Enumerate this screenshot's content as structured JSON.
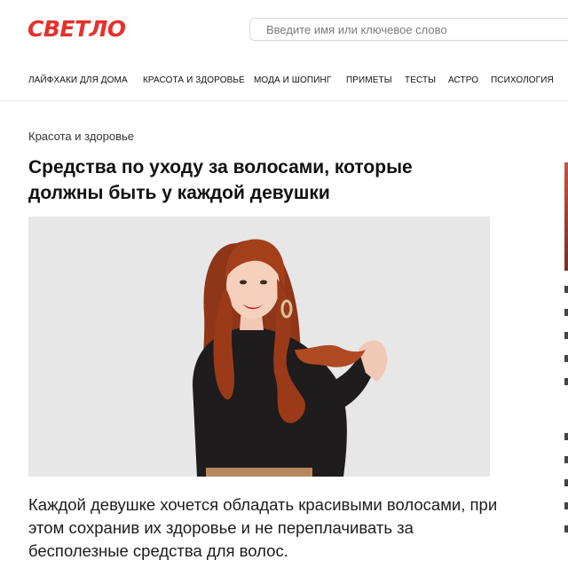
{
  "header": {
    "logo": "СВЕТЛО",
    "search_placeholder": "Введите имя или ключевое слово"
  },
  "nav": {
    "items": [
      "ЛАЙФХАКИ ДЛЯ ДОМА",
      "КРАСОТА И ЗДОРОВЬЕ",
      "МОДА И ШОПИНГ",
      "ПРИМЕТЫ",
      "ТЕСТЫ",
      "АСТРО",
      "ПСИХОЛОГИЯ"
    ]
  },
  "article": {
    "category": "Красота и здоровье",
    "title": "Средства по уходу за волосами, которые должны быть у каждой девушки",
    "lead": "Каждой девушке хочется обладать красивыми волосами, при этом сохранив их здоровье и не переплачивать за бесполезные средства для волос."
  },
  "colors": {
    "brand": "#e4322b",
    "background": "#ffffff",
    "text": "#111111"
  }
}
